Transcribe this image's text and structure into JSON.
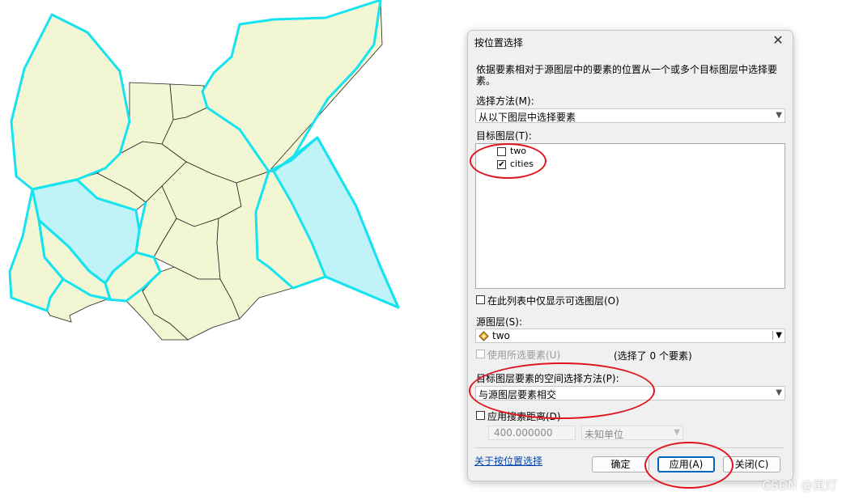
{
  "dialog": {
    "title": "按位置选择",
    "close_glyph": "✕",
    "description": "依据要素相对于源图层中的要素的位置从一个或多个目标图层中选择要素。",
    "method_label": "选择方法(M):",
    "method_value": "从以下图层中选择要素",
    "target_label": "目标图层(T):",
    "target_layers": [
      {
        "name": "two",
        "checked": false
      },
      {
        "name": "cities",
        "checked": true
      }
    ],
    "only_selectable_label": "在此列表中仅显示可选图层(O)",
    "source_label": "源图层(S):",
    "source_value": "two",
    "use_selected_label": "使用所选要素(U)",
    "selected_count": "(选择了 0 个要素)",
    "spatial_method_label": "目标图层要素的空间选择方法(P):",
    "spatial_method_value": "与源图层要素相交",
    "search_distance_label": "应用搜索距离(D)",
    "distance_value": "400.000000",
    "unit_value": "未知单位",
    "about_link": "关于按位置选择",
    "ok_label": "确定",
    "apply_label": "应用(A)",
    "close_label": "关闭(C)"
  },
  "checkmark_glyph": "✔",
  "watermark": "CSDN @寅灯",
  "colors": {
    "polygon_fill": "#f2f6d2",
    "selected_fill": "#bff3f8",
    "highlight_stroke": "#17e3f0",
    "annotation_red": "#e0141e"
  }
}
